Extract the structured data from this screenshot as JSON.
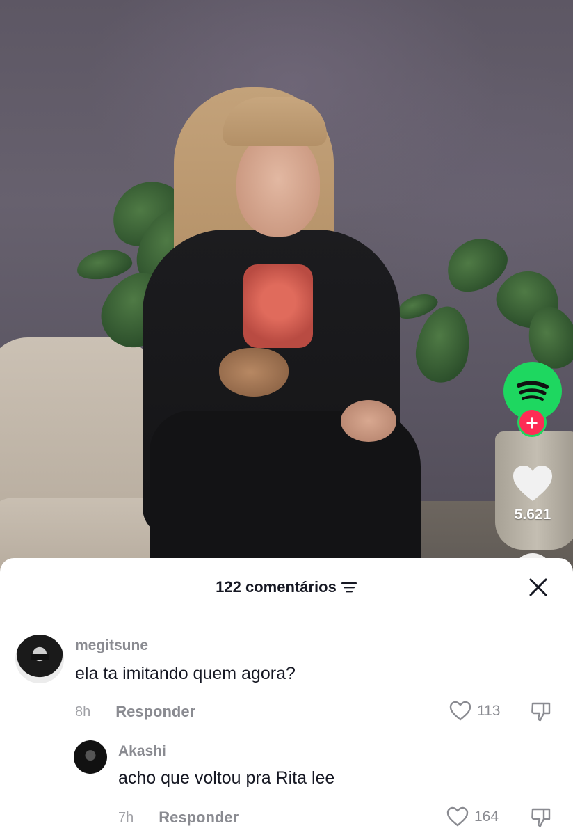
{
  "video": {
    "like_count": "5.621"
  },
  "colors": {
    "spotify_green": "#1ed760",
    "plus_red": "#fe2c55",
    "text_primary": "#161823",
    "text_secondary": "#8a8b91"
  },
  "comments_sheet": {
    "title": "122 comentários",
    "comments": [
      {
        "username": "megitsune",
        "text": "ela ta imitando quem agora?",
        "time": "8h",
        "reply_label": "Responder",
        "likes": "113"
      },
      {
        "username": "Akashi",
        "text": "acho que voltou pra Rita lee",
        "time": "7h",
        "reply_label": "Responder",
        "likes": "164"
      }
    ]
  }
}
